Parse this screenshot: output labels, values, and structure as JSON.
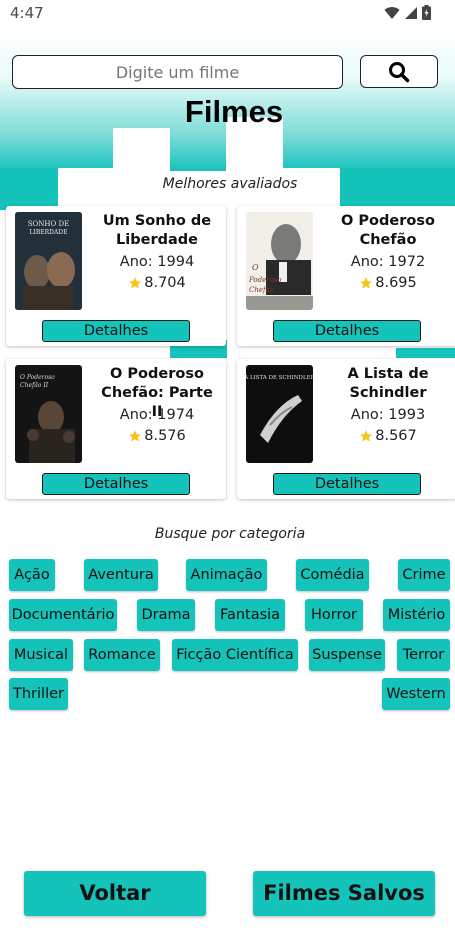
{
  "status_bar": {
    "time": "4:47"
  },
  "search": {
    "placeholder": "Digite um filme"
  },
  "header": {
    "title": "Filmes"
  },
  "top_rated": {
    "label": "Melhores avaliados",
    "movies": [
      {
        "title": "Um Sonho de Liberdade",
        "year": "Ano: 1994",
        "rating": "8.704",
        "details_label": "Detalhes",
        "poster_text": "SONHO DE LIBERDADE"
      },
      {
        "title": "O Poderoso Chefão",
        "year": "Ano: 1972",
        "rating": "8.695",
        "details_label": "Detalhes",
        "poster_text": "O Poderoso Chefão"
      },
      {
        "title": "O Poderoso Chefão: Parte II",
        "year": "Ano: 1974",
        "rating": "8.576",
        "details_label": "Detalhes",
        "poster_text": "O Poderoso Chefão"
      },
      {
        "title": "A Lista de Schindler",
        "year": "Ano: 1993",
        "rating": "8.567",
        "details_label": "Detalhes",
        "poster_text": "A LISTA DE SCHINDLER"
      }
    ]
  },
  "categories": {
    "label": "Busque por categoria",
    "items": [
      "Ação",
      "Aventura",
      "Animação",
      "Comédia",
      "Crime",
      "Documentário",
      "Drama",
      "Fantasia",
      "Horror",
      "Mistério",
      "Musical",
      "Romance",
      "Ficção Científica",
      "Suspense",
      "Terror",
      "Thriller",
      "Western"
    ]
  },
  "footer": {
    "back_label": "Voltar",
    "saved_label": "Filmes Salvos"
  },
  "colors": {
    "accent": "#14c3ba",
    "star": "#f5c518"
  }
}
